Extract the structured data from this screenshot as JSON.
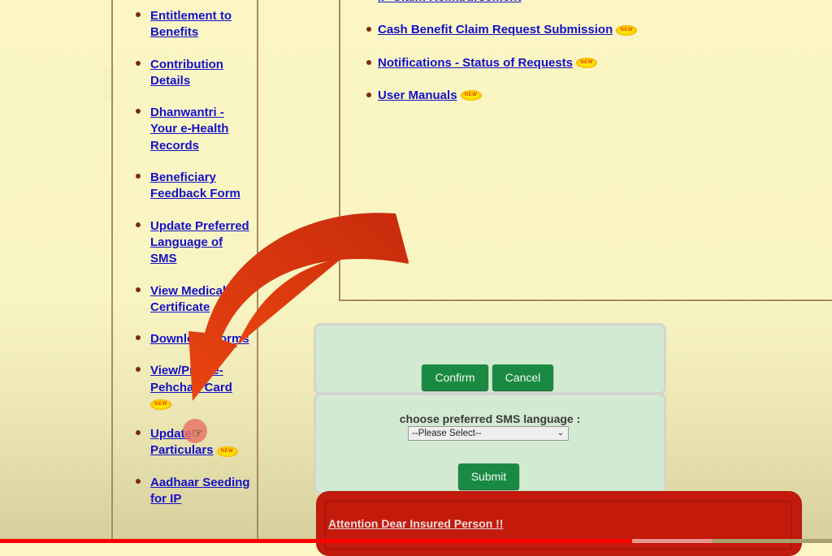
{
  "sidebar": {
    "items": [
      {
        "label": "Entitlement to Benefits",
        "new": false
      },
      {
        "label": "Contribution Details",
        "new": false
      },
      {
        "label": "Dhanwantri - Your e-Health Records",
        "new": false
      },
      {
        "label": "Beneficiary Feedback Form",
        "new": false
      },
      {
        "label": "Update Preferred Language of SMS",
        "new": false
      },
      {
        "label": "View Medical Certificate",
        "new": false
      },
      {
        "label": "Download Forms",
        "new": false
      },
      {
        "label": "View/Print e-Pehchan Card",
        "new": true
      },
      {
        "label": "Update Particulars",
        "new": true
      },
      {
        "label": "Aadhaar Seeding for IP",
        "new": false
      }
    ]
  },
  "main_links": [
    {
      "label": "IP Claim Reimbursement",
      "new": false
    },
    {
      "label": "Cash Benefit Claim Request Submission",
      "new": true
    },
    {
      "label": "Notifications - Status of Requests",
      "new": true
    },
    {
      "label": "User Manuals",
      "new": true
    }
  ],
  "badge": {
    "new_label": "NEW"
  },
  "dialog": {
    "confirm_label": "Confirm",
    "cancel_label": "Cancel",
    "sms_language_label": "choose preferred SMS language :",
    "sms_language_selected": "--Please Select--",
    "submit_label": "Submit"
  },
  "attention": {
    "title": "Attention Dear Insured Person !!"
  },
  "video_progress": {
    "played_fraction": 0.76,
    "buffered_fraction": 0.855
  },
  "colors": {
    "link": "#1411c9",
    "button": "#1a8a43",
    "attention": "#c41a0c",
    "arrow": "#e23a10"
  }
}
